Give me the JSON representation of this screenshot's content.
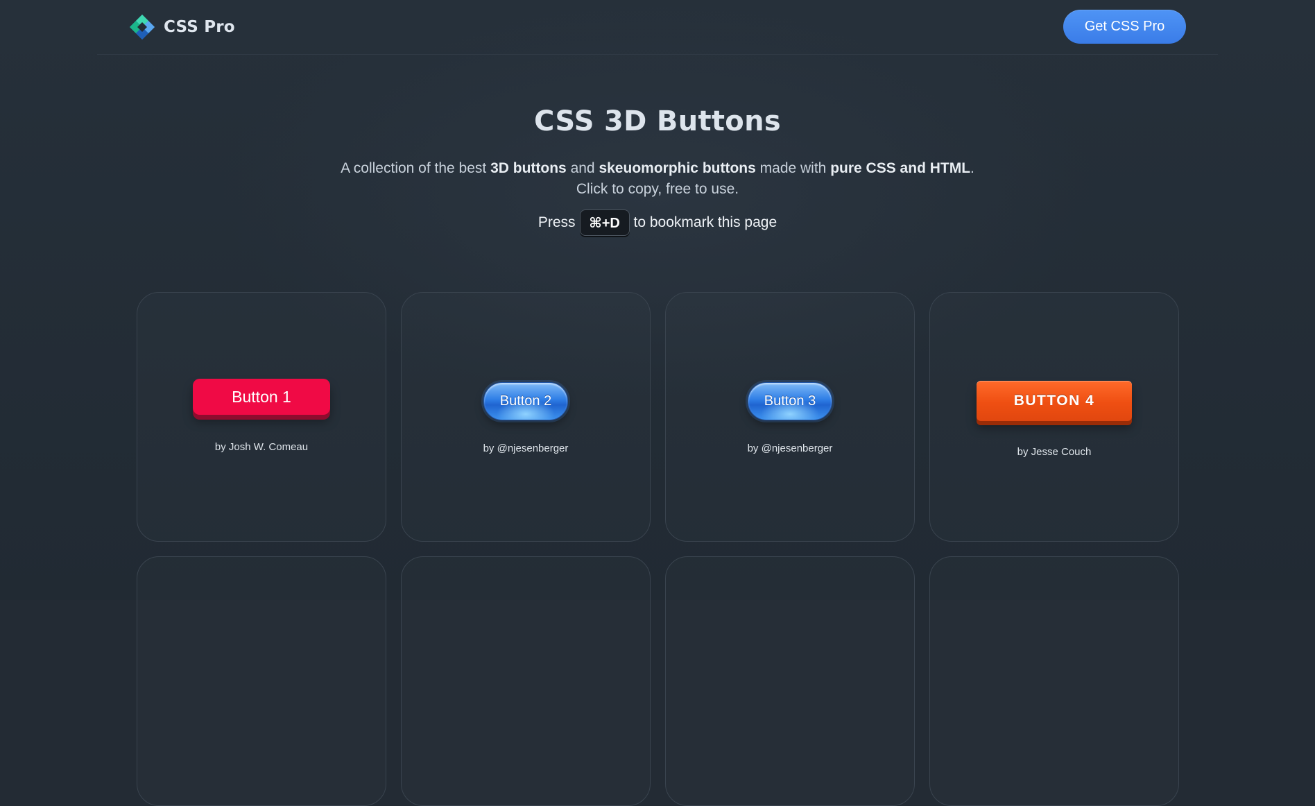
{
  "brand": {
    "name": "CSS Pro",
    "logo_icon": "diamond-logo-icon"
  },
  "header": {
    "cta_label": "Get CSS Pro"
  },
  "hero": {
    "title": "CSS 3D Buttons",
    "desc_1": "A collection of the best ",
    "desc_b1": "3D buttons",
    "desc_2": " and ",
    "desc_b2": "skeuomorphic buttons",
    "desc_3": " made with ",
    "desc_b3": "pure CSS and HTML",
    "desc_4": ".",
    "desc_line2": "Click to copy, free to use.",
    "press_before": "Press",
    "shortcut": "⌘+D",
    "press_after": "to bookmark this page"
  },
  "cards": [
    {
      "label": "Button 1",
      "author": "by Josh W. Comeau"
    },
    {
      "label": "Button 2",
      "author": "by @njesenberger"
    },
    {
      "label": "Button 3",
      "author": "by @njesenberger"
    },
    {
      "label": "BUTTON 4",
      "author": "by Jesse Couch"
    }
  ],
  "colors": {
    "accent": "#3f86ee",
    "button1": "#f00a45",
    "button2": "#2f7ee6",
    "button4": "#ef4f12",
    "background": "#232b34"
  }
}
